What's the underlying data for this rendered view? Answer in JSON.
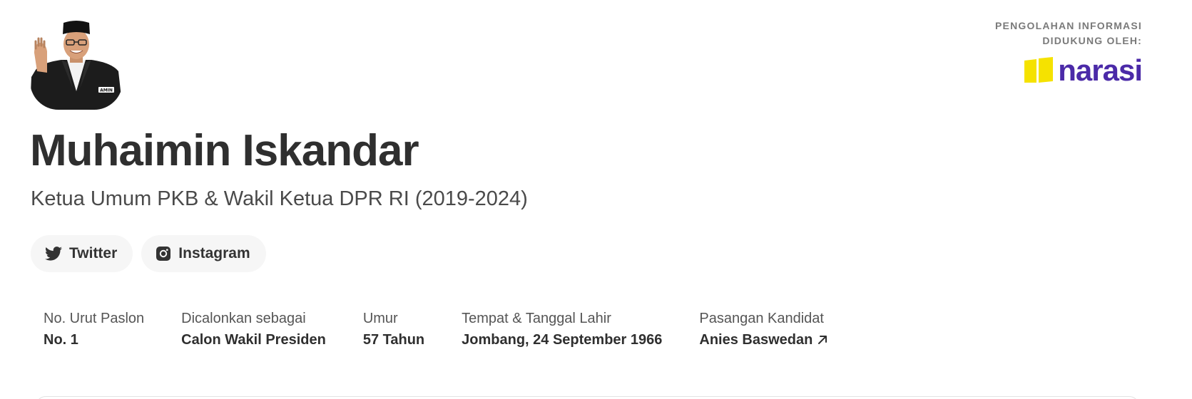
{
  "sponsor": {
    "line1": "PENGOLAHAN INFORMASI",
    "line2": "DIDUKUNG OLEH:",
    "logo_text": "narasi",
    "logo_mark_color": "#f5e200",
    "logo_text_color": "#4b2aa8"
  },
  "candidate": {
    "name": "Muhaimin Iskandar",
    "title": "Ketua Umum PKB & Wakil Ketua DPR RI (2019-2024)",
    "badge_text": "AMIN"
  },
  "socials": [
    {
      "label": "Twitter",
      "icon": "twitter-icon"
    },
    {
      "label": "Instagram",
      "icon": "instagram-icon"
    }
  ],
  "info": [
    {
      "label": "No. Urut Paslon",
      "value": "No. 1"
    },
    {
      "label": "Dicalonkan sebagai",
      "value": "Calon Wakil Presiden"
    },
    {
      "label": "Umur",
      "value": "57 Tahun"
    },
    {
      "label": "Tempat & Tanggal Lahir",
      "value": "Jombang, 24 September 1966"
    },
    {
      "label": "Pasangan Kandidat",
      "value": "Anies Baswedan",
      "icon": "arrow-up-right-icon"
    }
  ]
}
